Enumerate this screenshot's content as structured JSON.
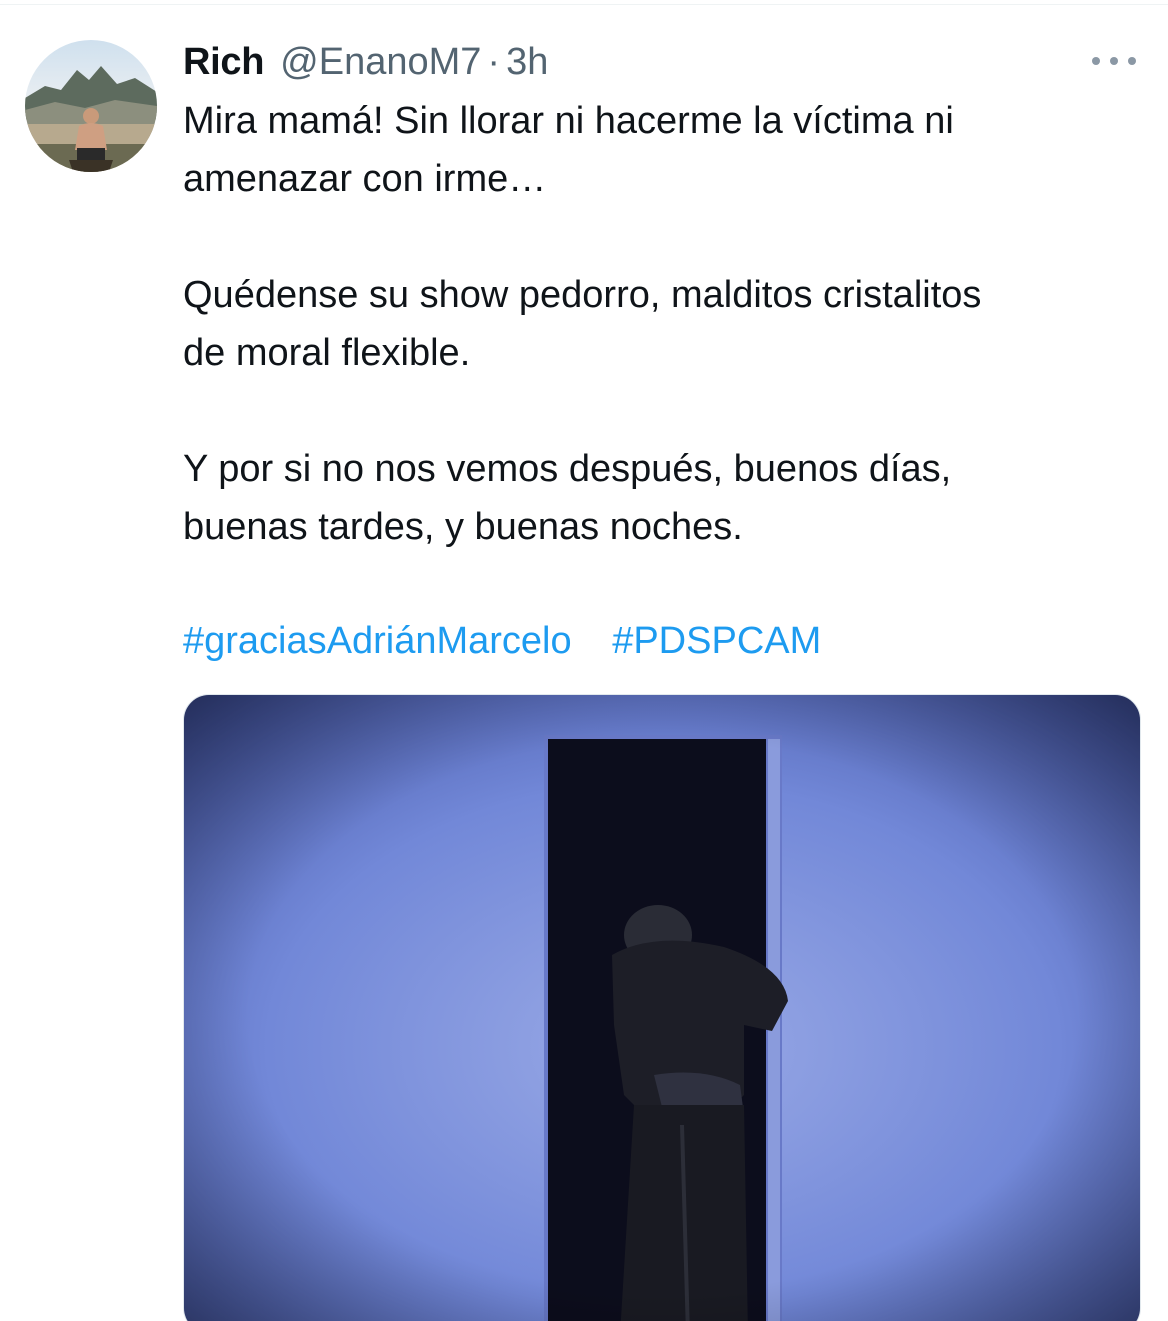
{
  "tweet": {
    "author": {
      "display_name": "Rich",
      "handle": "@EnanoM7",
      "separator": "·",
      "time": "3h"
    },
    "text_lines": {
      "p1_l1": "Mira mamá! Sin llorar ni hacerme la víctima ni",
      "p1_l2": "amenazar con irme…",
      "p2_l1": "Quédense su show pedorro, malditos cristalitos",
      "p2_l2": "de moral flexible.",
      "p3_l1": "Y por si no nos vemos después, buenos días,",
      "p3_l2": "buenas tardes, y buenas noches."
    },
    "hashtags": [
      "#graciasAdriánMarcelo",
      "#PDSPCAM"
    ],
    "more_icon": "more-horizontal-icon"
  },
  "colors": {
    "text": "#0f1419",
    "secondary": "#536471",
    "link": "#1d9bf0",
    "media_wall": "#6f84d8"
  }
}
